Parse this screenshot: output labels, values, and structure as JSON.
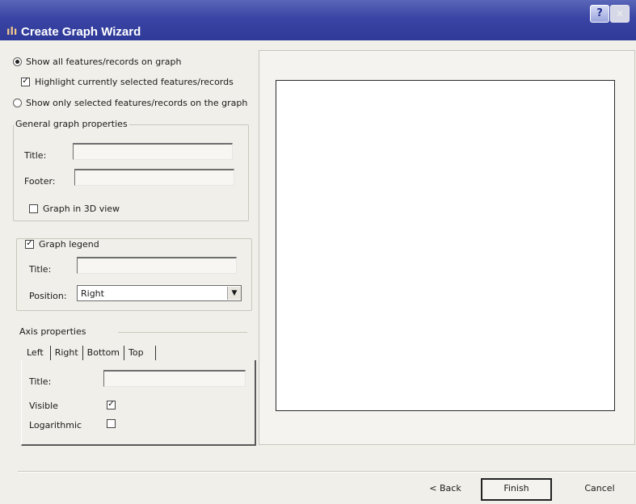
{
  "window": {
    "title": "Create Graph Wizard",
    "help_label": "?",
    "close_label": "✕"
  },
  "display_options": {
    "show_all_label": "Show all features/records on graph",
    "show_all_selected": true,
    "highlight_label": "Highlight currently selected features/records",
    "highlight_checked": true,
    "show_selected_label": "Show only selected features/records on the graph",
    "show_selected_selected": false
  },
  "general_props": {
    "group_label": "General graph properties",
    "title_label": "Title:",
    "title_value": "",
    "footer_label": "Footer:",
    "footer_value": "",
    "view3d_label": "Graph in 3D view",
    "view3d_checked": false
  },
  "legend": {
    "group_label": "Graph legend",
    "enabled": true,
    "title_label": "Title:",
    "title_value": "",
    "position_label": "Position:",
    "position_value": "Right"
  },
  "axis": {
    "group_label": "Axis properties",
    "tabs": [
      "Left",
      "Right",
      "Bottom",
      "Top"
    ],
    "active_tab": "Left",
    "title_label": "Title:",
    "title_value": "",
    "visible_label": "Visible",
    "visible_checked": true,
    "log_label": "Logarithmic",
    "log_checked": false
  },
  "buttons": {
    "back": "< Back",
    "finish": "Finish",
    "cancel": "Cancel"
  },
  "icons": {
    "app": "graph-wizard-icon",
    "dropdown": "chevron-down-icon"
  }
}
